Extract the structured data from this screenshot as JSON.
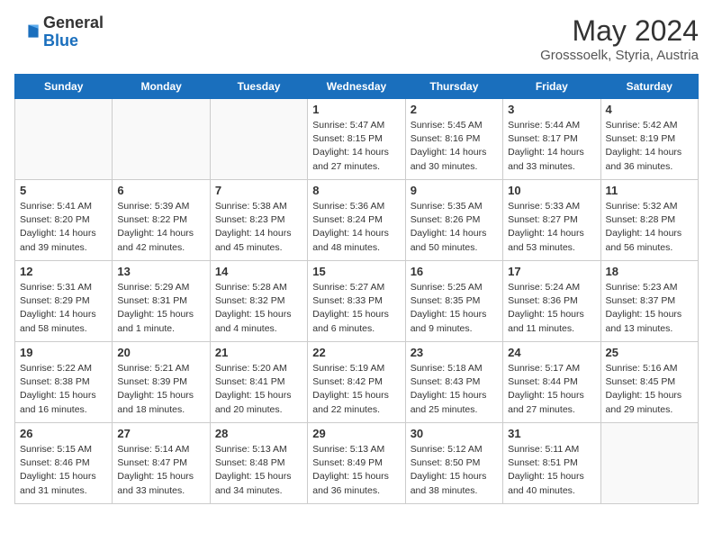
{
  "header": {
    "logo_general": "General",
    "logo_blue": "Blue",
    "month_title": "May 2024",
    "location": "Grosssoelk, Styria, Austria"
  },
  "days_of_week": [
    "Sunday",
    "Monday",
    "Tuesday",
    "Wednesday",
    "Thursday",
    "Friday",
    "Saturday"
  ],
  "weeks": [
    [
      {
        "day": "",
        "info": ""
      },
      {
        "day": "",
        "info": ""
      },
      {
        "day": "",
        "info": ""
      },
      {
        "day": "1",
        "info": "Sunrise: 5:47 AM\nSunset: 8:15 PM\nDaylight: 14 hours and 27 minutes."
      },
      {
        "day": "2",
        "info": "Sunrise: 5:45 AM\nSunset: 8:16 PM\nDaylight: 14 hours and 30 minutes."
      },
      {
        "day": "3",
        "info": "Sunrise: 5:44 AM\nSunset: 8:17 PM\nDaylight: 14 hours and 33 minutes."
      },
      {
        "day": "4",
        "info": "Sunrise: 5:42 AM\nSunset: 8:19 PM\nDaylight: 14 hours and 36 minutes."
      }
    ],
    [
      {
        "day": "5",
        "info": "Sunrise: 5:41 AM\nSunset: 8:20 PM\nDaylight: 14 hours and 39 minutes."
      },
      {
        "day": "6",
        "info": "Sunrise: 5:39 AM\nSunset: 8:22 PM\nDaylight: 14 hours and 42 minutes."
      },
      {
        "day": "7",
        "info": "Sunrise: 5:38 AM\nSunset: 8:23 PM\nDaylight: 14 hours and 45 minutes."
      },
      {
        "day": "8",
        "info": "Sunrise: 5:36 AM\nSunset: 8:24 PM\nDaylight: 14 hours and 48 minutes."
      },
      {
        "day": "9",
        "info": "Sunrise: 5:35 AM\nSunset: 8:26 PM\nDaylight: 14 hours and 50 minutes."
      },
      {
        "day": "10",
        "info": "Sunrise: 5:33 AM\nSunset: 8:27 PM\nDaylight: 14 hours and 53 minutes."
      },
      {
        "day": "11",
        "info": "Sunrise: 5:32 AM\nSunset: 8:28 PM\nDaylight: 14 hours and 56 minutes."
      }
    ],
    [
      {
        "day": "12",
        "info": "Sunrise: 5:31 AM\nSunset: 8:29 PM\nDaylight: 14 hours and 58 minutes."
      },
      {
        "day": "13",
        "info": "Sunrise: 5:29 AM\nSunset: 8:31 PM\nDaylight: 15 hours and 1 minute."
      },
      {
        "day": "14",
        "info": "Sunrise: 5:28 AM\nSunset: 8:32 PM\nDaylight: 15 hours and 4 minutes."
      },
      {
        "day": "15",
        "info": "Sunrise: 5:27 AM\nSunset: 8:33 PM\nDaylight: 15 hours and 6 minutes."
      },
      {
        "day": "16",
        "info": "Sunrise: 5:25 AM\nSunset: 8:35 PM\nDaylight: 15 hours and 9 minutes."
      },
      {
        "day": "17",
        "info": "Sunrise: 5:24 AM\nSunset: 8:36 PM\nDaylight: 15 hours and 11 minutes."
      },
      {
        "day": "18",
        "info": "Sunrise: 5:23 AM\nSunset: 8:37 PM\nDaylight: 15 hours and 13 minutes."
      }
    ],
    [
      {
        "day": "19",
        "info": "Sunrise: 5:22 AM\nSunset: 8:38 PM\nDaylight: 15 hours and 16 minutes."
      },
      {
        "day": "20",
        "info": "Sunrise: 5:21 AM\nSunset: 8:39 PM\nDaylight: 15 hours and 18 minutes."
      },
      {
        "day": "21",
        "info": "Sunrise: 5:20 AM\nSunset: 8:41 PM\nDaylight: 15 hours and 20 minutes."
      },
      {
        "day": "22",
        "info": "Sunrise: 5:19 AM\nSunset: 8:42 PM\nDaylight: 15 hours and 22 minutes."
      },
      {
        "day": "23",
        "info": "Sunrise: 5:18 AM\nSunset: 8:43 PM\nDaylight: 15 hours and 25 minutes."
      },
      {
        "day": "24",
        "info": "Sunrise: 5:17 AM\nSunset: 8:44 PM\nDaylight: 15 hours and 27 minutes."
      },
      {
        "day": "25",
        "info": "Sunrise: 5:16 AM\nSunset: 8:45 PM\nDaylight: 15 hours and 29 minutes."
      }
    ],
    [
      {
        "day": "26",
        "info": "Sunrise: 5:15 AM\nSunset: 8:46 PM\nDaylight: 15 hours and 31 minutes."
      },
      {
        "day": "27",
        "info": "Sunrise: 5:14 AM\nSunset: 8:47 PM\nDaylight: 15 hours and 33 minutes."
      },
      {
        "day": "28",
        "info": "Sunrise: 5:13 AM\nSunset: 8:48 PM\nDaylight: 15 hours and 34 minutes."
      },
      {
        "day": "29",
        "info": "Sunrise: 5:13 AM\nSunset: 8:49 PM\nDaylight: 15 hours and 36 minutes."
      },
      {
        "day": "30",
        "info": "Sunrise: 5:12 AM\nSunset: 8:50 PM\nDaylight: 15 hours and 38 minutes."
      },
      {
        "day": "31",
        "info": "Sunrise: 5:11 AM\nSunset: 8:51 PM\nDaylight: 15 hours and 40 minutes."
      },
      {
        "day": "",
        "info": ""
      }
    ]
  ]
}
